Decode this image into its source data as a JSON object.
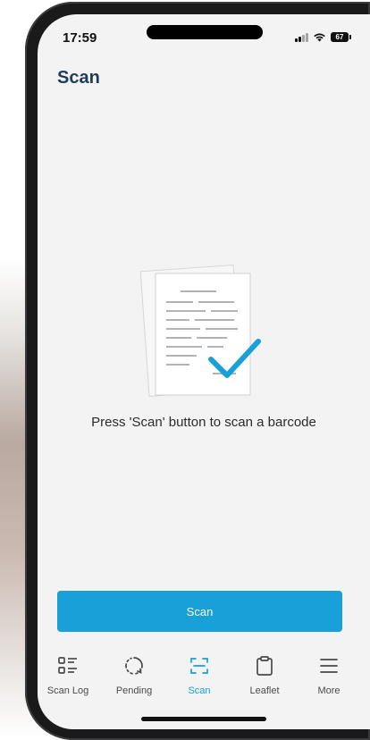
{
  "status_bar": {
    "time": "17:59",
    "battery": "67",
    "icons": [
      "signal-icon",
      "wifi-icon",
      "battery-icon"
    ]
  },
  "header": {
    "title": "Scan"
  },
  "empty_state": {
    "illustration": "documents-checkmark-icon",
    "message": "Press 'Scan' button to scan a barcode"
  },
  "actions": {
    "scan_label": "Scan"
  },
  "tabs": [
    {
      "label": "Scan Log",
      "icon": "scan-log-icon",
      "active": false
    },
    {
      "label": "Pending",
      "icon": "pending-icon",
      "active": false
    },
    {
      "label": "Scan",
      "icon": "scan-icon",
      "active": true
    },
    {
      "label": "Leaflet",
      "icon": "leaflet-icon",
      "active": false
    },
    {
      "label": "More",
      "icon": "menu-icon",
      "active": false
    }
  ],
  "colors": {
    "accent": "#1aa0d8",
    "title": "#1f3d57",
    "background": "#f3f3f3",
    "tab_inactive": "#4a4a4a"
  }
}
